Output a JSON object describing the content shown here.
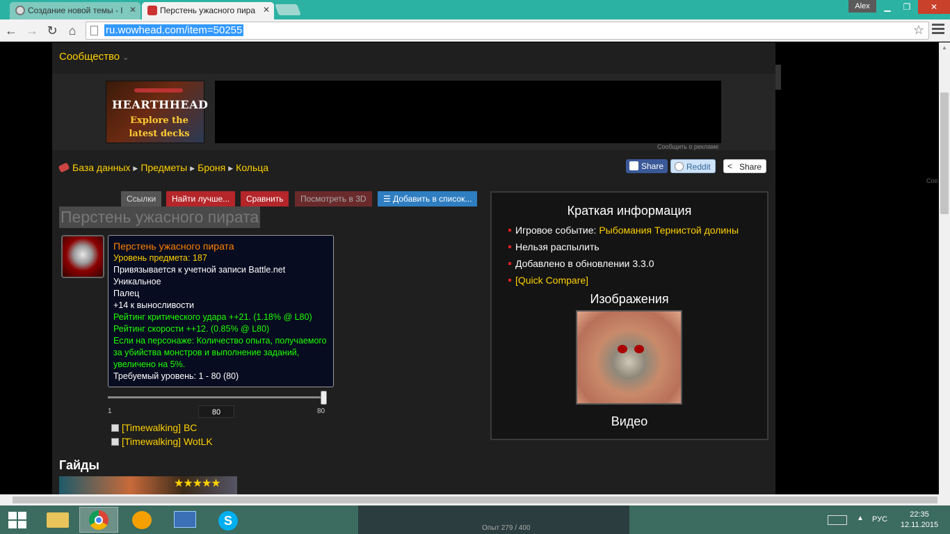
{
  "browser": {
    "tabs": [
      {
        "title": "Создание новой темы - I",
        "active": false
      },
      {
        "title": "Перстень ужасного пира",
        "active": true
      }
    ],
    "user": "Alex",
    "url": "ru.wowhead.com/item=50255"
  },
  "site": {
    "community_label": "Сообщество",
    "ad": {
      "title": "HEARTHHEAD",
      "line1": "Explore the",
      "line2": "latest decks",
      "note": "Сообщить о рекламе"
    },
    "breadcrumbs": [
      "База данных",
      "Предметы",
      "Броня",
      "Кольца"
    ],
    "share": {
      "facebook": "Share",
      "reddit": "Reddit",
      "generic": "Share"
    },
    "side_label": "Coo"
  },
  "item": {
    "buttons": {
      "links": "Ссылки",
      "find_better": "Найти лучше...",
      "compare": "Сравнить",
      "view_3d": "Посмотреть в 3D",
      "add_to_list": "Добавить в список..."
    },
    "title": "Перстень ужасного пирата",
    "tooltip": {
      "name": "Перстень ужасного пирата",
      "item_level": "Уровень предмета: 187",
      "binds": "Привязывается к учетной записи Battle.net",
      "unique": "Уникальное",
      "slot": "Палец",
      "stamina": "+14 к выносливости",
      "crit": "Рейтинг критического удара ++21. (1.18% @ L80)",
      "haste": "Рейтинг скорости ++12. (0.85% @ L80)",
      "equip": "Если на персонаже: Количество опыта, получаемого за убийства монстров и выполнение заданий, увеличено на 5%.",
      "required_level": "Требуемый уровень: 1 - 80 (80)"
    },
    "level_slider": {
      "min": "1",
      "max": "80",
      "value": "80"
    },
    "options": [
      "[Timewalking] BC",
      "[Timewalking] WotLK"
    ],
    "guides_heading": "Гайды"
  },
  "quick_info": {
    "title": "Краткая информация",
    "event_label": "Игровое событие:",
    "event_value": "Рыбомания Тернистой долины",
    "disenchant": "Нельзя распылить",
    "added": "Добавлено в обновлении 3.3.0",
    "quick_compare": "[Quick Compare]",
    "images_heading": "Изображения",
    "video_heading": "Видео"
  },
  "taskbar": {
    "game_xp": "Опыт 279 / 400",
    "language": "РУС",
    "time": "22:35",
    "date": "12.11.2015"
  },
  "colors": {
    "accent_gold": "#ffd100",
    "tooltip_bg": "#070c21",
    "stat_green": "#1eff00",
    "button_red": "#b4262a",
    "button_blue": "#2f7ec1"
  }
}
